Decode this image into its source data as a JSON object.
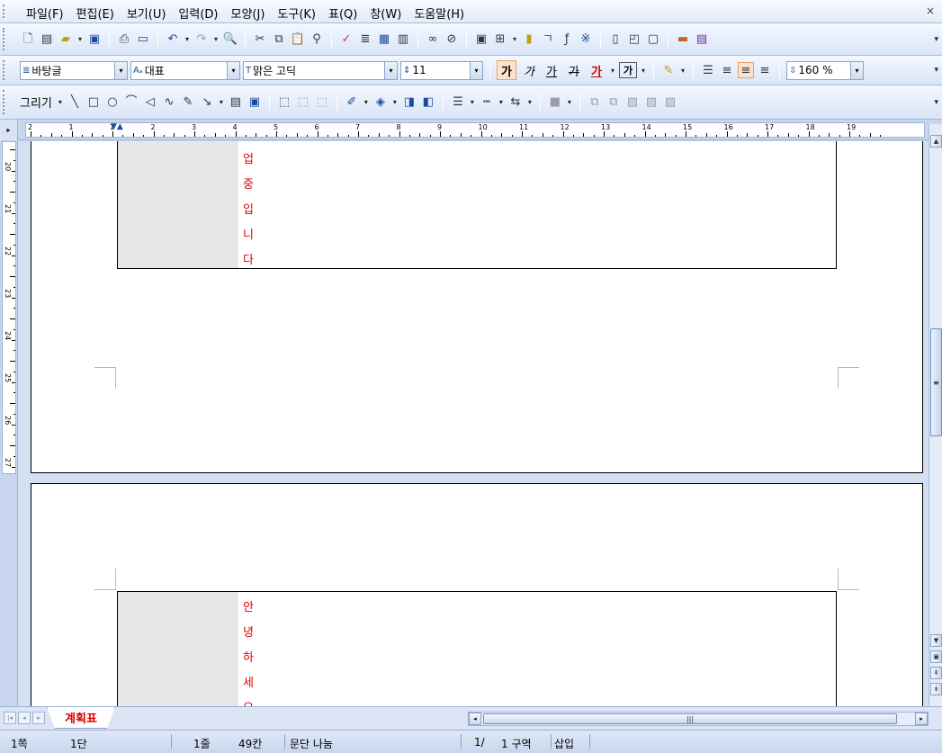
{
  "menu": [
    "파일(F)",
    "편집(E)",
    "보기(U)",
    "입력(D)",
    "모양(J)",
    "도구(K)",
    "표(Q)",
    "창(W)",
    "도움말(H)"
  ],
  "window_close": "×",
  "toolbar1": {
    "icons": [
      "new-doc-icon",
      "template-icon",
      "open-folder-icon",
      "save-icon",
      "print-icon",
      "preview-icon",
      "undo-icon",
      "redo-icon",
      "find-icon",
      "cut-icon",
      "copy-icon",
      "paste-icon",
      "format-painter-icon",
      "spellcheck-icon",
      "para-format-icon",
      "style-icon",
      "table-grid-icon",
      "hyperlink-icon",
      "unlink-icon",
      "picture-icon",
      "table-icon",
      "chart-icon",
      "hanja-icon",
      "formula-icon",
      "symbol-icon",
      "textbox-icon",
      "shape-icon",
      "frame-icon",
      "memo-icon",
      "outline-icon"
    ]
  },
  "toolbar2": {
    "style_value": "바탕글",
    "font_lang_value": "대표",
    "font_value": "맑은 고딕",
    "font_size_value": "11",
    "bold_label": "가",
    "italic_label": "가",
    "underline_label": "가",
    "strike_label": "가",
    "font_color_label": "가",
    "char_shape_label": "가",
    "line_spacing_value": "160 %"
  },
  "toolbar3": {
    "draw_label": "그리기"
  },
  "ruler": {
    "numbers": [
      "2",
      "1",
      "1",
      "2",
      "3",
      "4",
      "5",
      "6",
      "7",
      "8",
      "9",
      "10",
      "11",
      "12",
      "13",
      "14",
      "15",
      "16",
      "17",
      "18",
      "19"
    ],
    "vnumbers": [
      "20",
      "21",
      "22",
      "23",
      "24",
      "25",
      "26",
      "27"
    ]
  },
  "document": {
    "page1_chars": [
      "업",
      "중",
      "입",
      "니",
      "다"
    ],
    "page2_chars": [
      "안",
      "녕",
      "하",
      "세",
      "요"
    ]
  },
  "sheet_tab": "계획표",
  "status": {
    "page": "1쪽",
    "column": "1단",
    "line": "1줄",
    "col_pos": "49칸",
    "layout": "문단 나눔",
    "section_page": "1/",
    "section": "1 구역",
    "mode": "삽입"
  },
  "colors": {
    "accent_red": "#e00000",
    "toolbar_blue": "#d9e5f7",
    "cell_grey": "#e6e6e6"
  }
}
